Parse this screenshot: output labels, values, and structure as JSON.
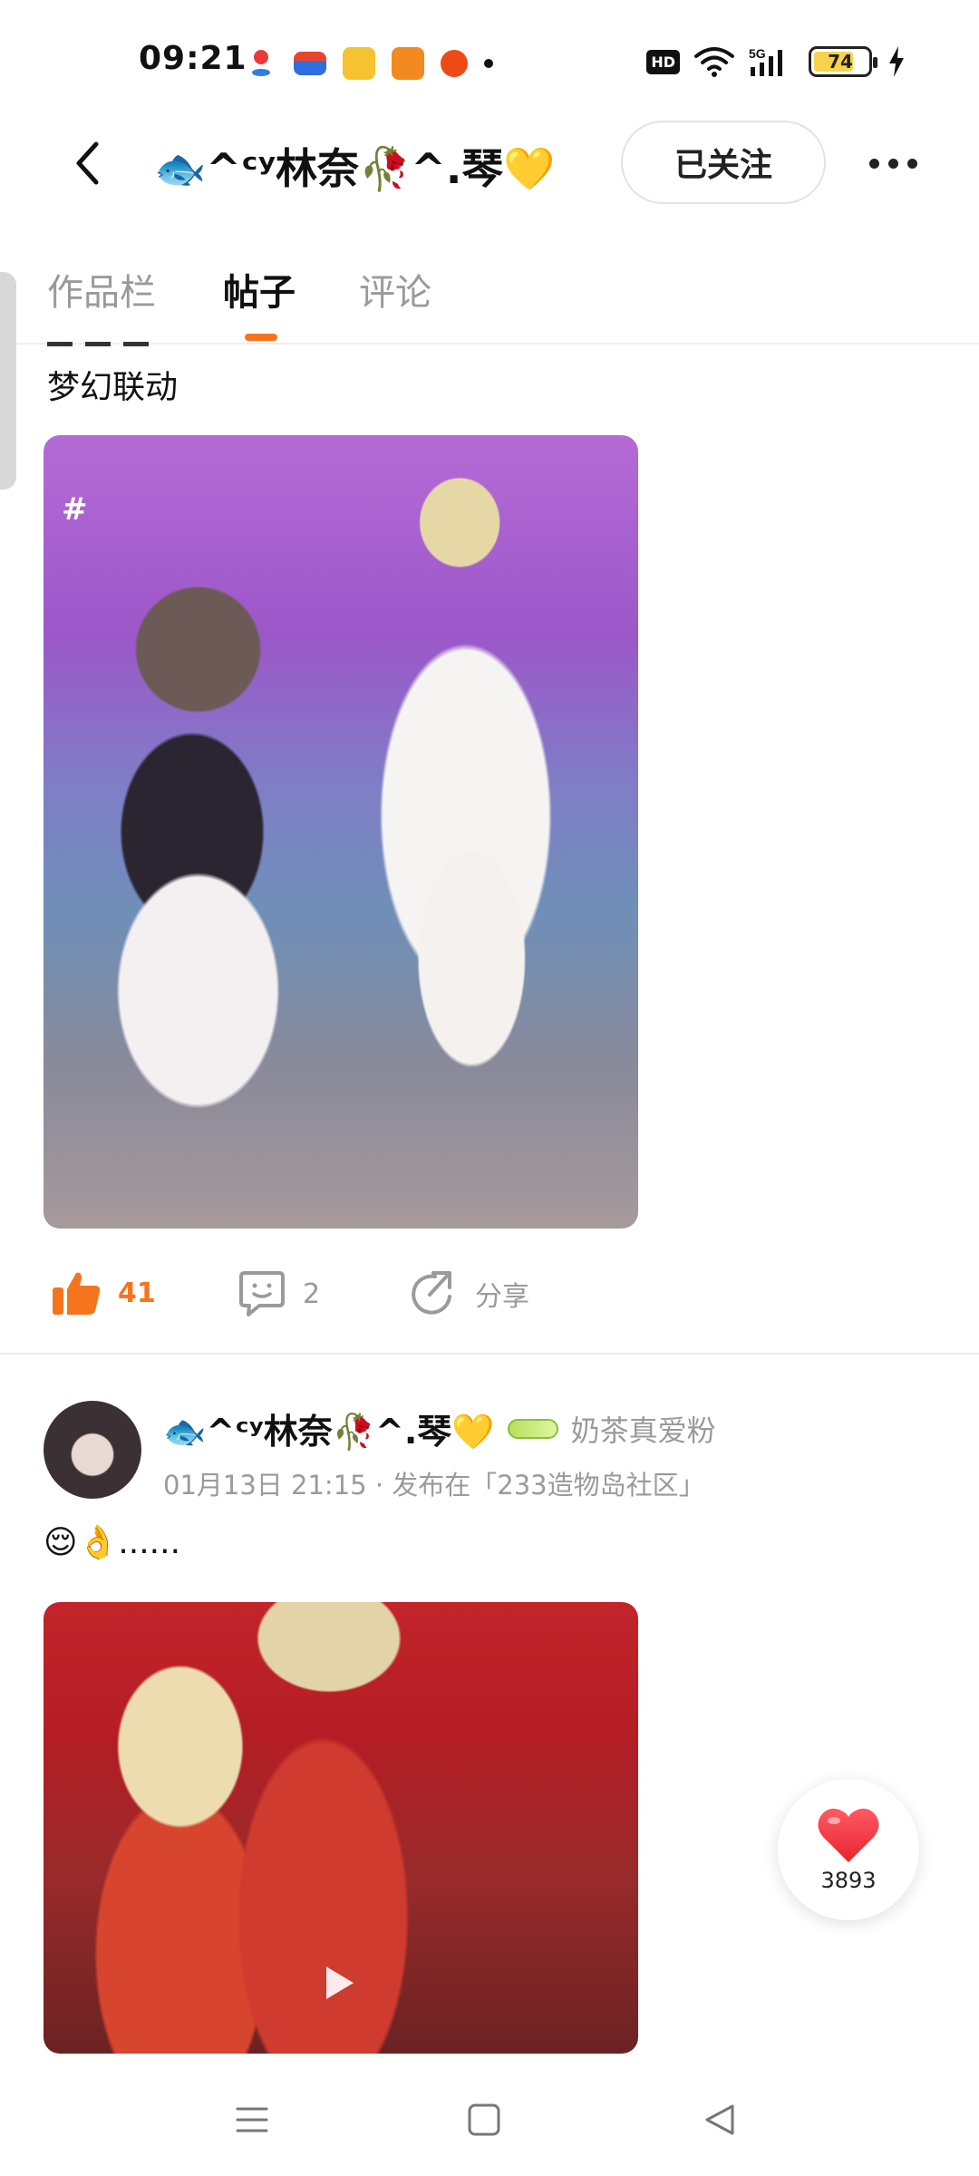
{
  "status_bar": {
    "time": "09:21",
    "network": "5G",
    "hd": "HD",
    "battery": "74",
    "battery_level": 0.74,
    "notification_icons": [
      "map-icon",
      "mail-icon",
      "book-icon",
      "fox-app-icon",
      "taobao-icon"
    ]
  },
  "header": {
    "title": "🐟^ᶜʸ林奈🥀^.琴💛",
    "follow_label": "已关注"
  },
  "tabs": [
    {
      "label": "作品栏",
      "active": false
    },
    {
      "label": "帖子",
      "active": true
    },
    {
      "label": "评论",
      "active": false
    }
  ],
  "posts": [
    {
      "text": "梦幻联动",
      "image_tag": "#",
      "likes": "41",
      "comments": "2",
      "share_label": "分享"
    },
    {
      "author": "🐟^ᶜʸ林奈🥀^.琴💛",
      "fan_title": "奶茶真爱粉",
      "meta": "01月13日 21:15 · 发布在「233造物岛社区」",
      "text": "😌👌......"
    }
  ],
  "floating_like": {
    "count": "3893"
  },
  "colors": {
    "accent": "#f5741d",
    "heart": "#f0323f"
  }
}
